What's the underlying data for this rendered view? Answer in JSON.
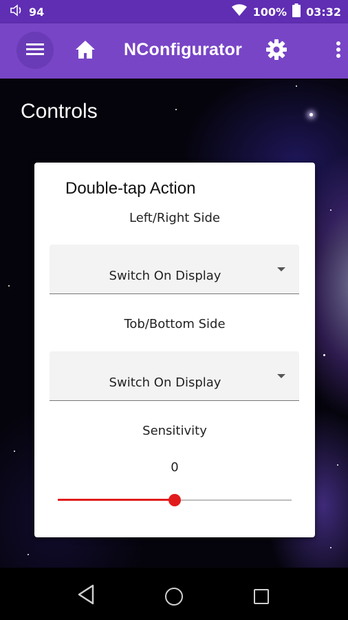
{
  "status_bar": {
    "volume_level": "94",
    "battery": "100%",
    "time": "03:32",
    "icons": [
      "volume-icon",
      "wifi-icon",
      "battery-icon"
    ]
  },
  "app_bar": {
    "title": "NConfigurator",
    "icons": [
      "menu-icon",
      "home-icon",
      "gear-icon",
      "more-vert-icon"
    ],
    "color": "#7845c6"
  },
  "page": {
    "title": "Controls"
  },
  "card": {
    "title": "Double-tap Action",
    "left_right": {
      "label": "Left/Right Side",
      "value": "Switch On Display"
    },
    "top_bottom": {
      "label": "Tob/Bottom Side",
      "value": "Switch On Display"
    },
    "sensitivity": {
      "label": "Sensitivity",
      "value": "0",
      "fraction": 0.5,
      "color": "#e11b1b"
    }
  },
  "nav_bar": {
    "icons": [
      "back-icon",
      "home-circle-icon",
      "recents-icon"
    ]
  }
}
